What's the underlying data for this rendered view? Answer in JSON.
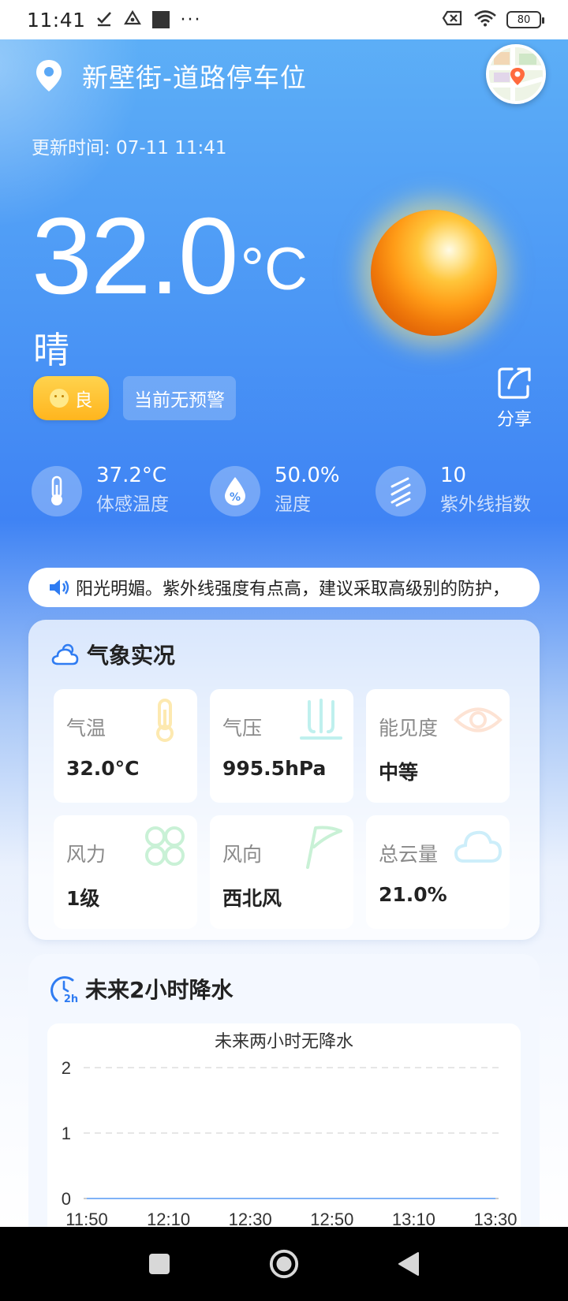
{
  "status_bar": {
    "time": "11:41",
    "battery": "80",
    "icons": [
      "check-icon",
      "cloud-warning-icon",
      "square-icon",
      "more-icon",
      "sim-off-icon",
      "wifi-icon",
      "battery-icon"
    ],
    "more": "···"
  },
  "header": {
    "location": "新壁街-道路停车位",
    "update_label": "更新时间: 07-11 11:41"
  },
  "current": {
    "temperature": "32.0",
    "unit": "°C",
    "description": "晴",
    "aqi_label": "良",
    "alert_text": "当前无预警",
    "share_label": "分享"
  },
  "metrics": [
    {
      "value": "37.2°C",
      "label": "体感温度",
      "icon": "thermometer-icon"
    },
    {
      "value": "50.0%",
      "label": "湿度",
      "icon": "humidity-icon"
    },
    {
      "value": "10",
      "label": "紫外线指数",
      "icon": "uv-icon"
    }
  ],
  "ticker": {
    "text": "阳光明媚。紫外线强度有点高，建议采取高级别的防护，"
  },
  "conditions": {
    "title": "气象实况",
    "cells": [
      {
        "label": "气温",
        "value": "32.0°C",
        "icon": "thermometer-icon"
      },
      {
        "label": "气压",
        "value": "995.5hPa",
        "icon": "pressure-icon"
      },
      {
        "label": "能见度",
        "value": "中等",
        "icon": "eye-icon"
      },
      {
        "label": "风力",
        "value": "1级",
        "icon": "fan-icon"
      },
      {
        "label": "风向",
        "value": "西北风",
        "icon": "flag-icon"
      },
      {
        "label": "总云量",
        "value": "21.0%",
        "icon": "cloud-icon"
      }
    ]
  },
  "precip": {
    "title": "未来2小时降水",
    "badge": "2h"
  },
  "colors": {
    "accent_yellow": "#ffc02a",
    "accent_blue": "#3f83f4",
    "deco_thermo": "#fde9b0",
    "deco_pressure": "#bff0ee",
    "deco_eye": "#fde3d4",
    "deco_fan": "#c9f1d6",
    "deco_flag": "#c9f1d6",
    "deco_cloud": "#cdeefa"
  },
  "chart_data": {
    "type": "line",
    "title": "未来两小时无降水",
    "x": [
      "11:50",
      "12:10",
      "12:30",
      "12:50",
      "13:10",
      "13:30"
    ],
    "series": [
      {
        "values": [
          0,
          0,
          0,
          0,
          0,
          0
        ]
      }
    ],
    "yticks": [
      0,
      1,
      2
    ],
    "ylim": [
      0,
      2
    ],
    "grid": true,
    "xlabel": "",
    "ylabel": ""
  }
}
